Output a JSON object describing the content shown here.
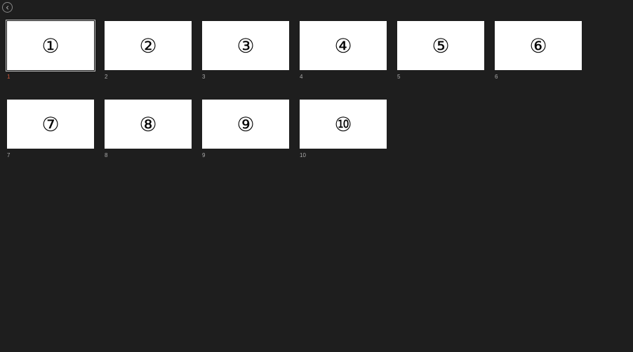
{
  "slides": [
    {
      "label": "1",
      "glyph": "①",
      "selected": true
    },
    {
      "label": "2",
      "glyph": "②",
      "selected": false
    },
    {
      "label": "3",
      "glyph": "③",
      "selected": false
    },
    {
      "label": "4",
      "glyph": "④",
      "selected": false
    },
    {
      "label": "5",
      "glyph": "⑤",
      "selected": false
    },
    {
      "label": "6",
      "glyph": "⑥",
      "selected": false
    },
    {
      "label": "7",
      "glyph": "⑦",
      "selected": false
    },
    {
      "label": "8",
      "glyph": "⑧",
      "selected": false
    },
    {
      "label": "9",
      "glyph": "⑨",
      "selected": false
    },
    {
      "label": "10",
      "glyph": "⑩",
      "selected": false
    }
  ]
}
